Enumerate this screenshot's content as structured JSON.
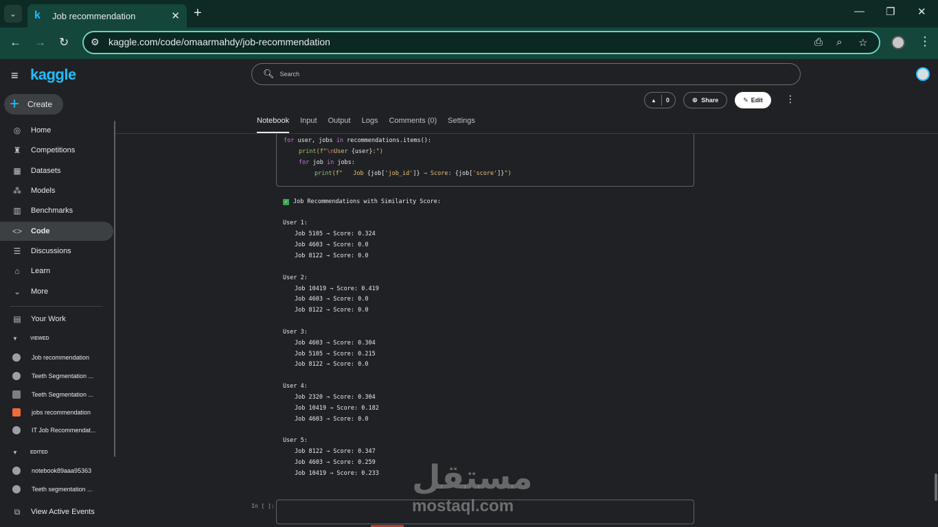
{
  "browser": {
    "tab_title": "Job recommendation",
    "url": "kaggle.com/code/omaarmahdy/job-recommendation"
  },
  "sidebar": {
    "logo": "kaggle",
    "create": "Create",
    "items": [
      {
        "label": "Home",
        "icon": "home-icon"
      },
      {
        "label": "Competitions",
        "icon": "trophy-icon"
      },
      {
        "label": "Datasets",
        "icon": "table-icon"
      },
      {
        "label": "Models",
        "icon": "models-icon"
      },
      {
        "label": "Benchmarks",
        "icon": "chart-icon"
      },
      {
        "label": "Code",
        "icon": "code-icon"
      },
      {
        "label": "Discussions",
        "icon": "comments-icon"
      },
      {
        "label": "Learn",
        "icon": "school-icon"
      },
      {
        "label": "More",
        "icon": "chevron-down-icon"
      }
    ],
    "your_work": "Your Work",
    "viewed_header": "VIEWED",
    "viewed": [
      "Job recommendation",
      "Teeth Segmentation ...",
      "Teeth Segmentation ...",
      "jobs recommendation",
      "IT Job Recommendat..."
    ],
    "edited_header": "EDITED",
    "edited": [
      "notebook89aaa95363",
      "Teeth segmentation ..."
    ],
    "view_active_events": "View Active Events"
  },
  "header": {
    "search_placeholder": "Search",
    "vote_count": "0",
    "share": "Share",
    "edit": "Edit"
  },
  "tabs": [
    "Notebook",
    "Input",
    "Output",
    "Logs",
    "Comments (0)",
    "Settings"
  ],
  "code": {
    "line1_a": "for",
    "line1_b": " user, jobs ",
    "line1_c": "in",
    "line1_d": " recommendations.items():",
    "line2_fn": "print",
    "line2_a": "(f\"",
    "line2_b": "\\n",
    "line2_c": "User ",
    "line2_d": "{user}",
    "line2_e": ":\")",
    "line3_a": "for",
    "line3_b": " job ",
    "line3_c": "in",
    "line3_d": " jobs:",
    "line4_fn": "print",
    "line4_a": "(f\"   Job ",
    "line4_b": "{job[",
    "line4_c": "'job_id'",
    "line4_d": "]}",
    "line4_e": " → Score: ",
    "line4_f": "{job[",
    "line4_g": "'score'",
    "line4_h": "]}",
    "line4_i": "\")"
  },
  "output": {
    "heading": "Job Recommendations with Similarity Score:",
    "users": [
      {
        "label": "User 1:",
        "jobs": [
          "Job 5105 → Score: 0.324",
          "Job 4603 → Score: 0.0",
          "Job 8122 → Score: 0.0"
        ]
      },
      {
        "label": "User 2:",
        "jobs": [
          "Job 10419 → Score: 0.419",
          "Job 4603 → Score: 0.0",
          "Job 8122 → Score: 0.0"
        ]
      },
      {
        "label": "User 3:",
        "jobs": [
          "Job 4603 → Score: 0.304",
          "Job 5105 → Score: 0.215",
          "Job 8122 → Score: 0.0"
        ]
      },
      {
        "label": "User 4:",
        "jobs": [
          "Job 2320 → Score: 0.304",
          "Job 10419 → Score: 0.182",
          "Job 4603 → Score: 0.0"
        ]
      },
      {
        "label": "User 5:",
        "jobs": [
          "Job 8122 → Score: 0.347",
          "Job 4603 → Score: 0.259",
          "Job 10419 → Score: 0.233"
        ]
      }
    ]
  },
  "input_cell_label": "In [ ]:",
  "watermark": {
    "arabic": "مستقل",
    "latin": "mostaql.com"
  }
}
